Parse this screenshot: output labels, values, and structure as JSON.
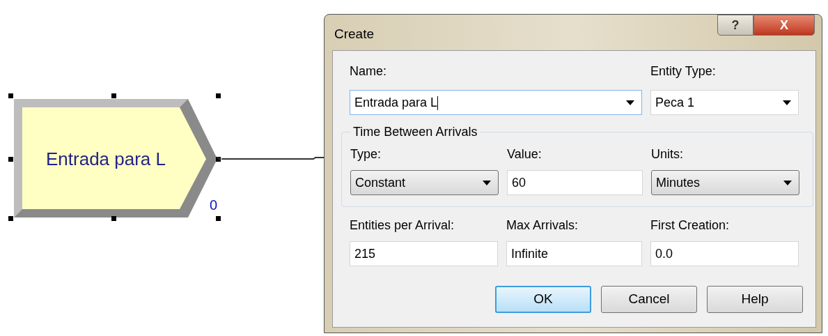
{
  "canvas": {
    "module": {
      "label": "Entrada para L",
      "selected": true,
      "counter": "0"
    }
  },
  "dialog": {
    "title": "Create",
    "title_buttons": [
      {
        "kind": "help",
        "label": "?"
      },
      {
        "kind": "close",
        "label": "X"
      }
    ],
    "name": {
      "label": "Name:",
      "value": "Entrada para L",
      "kind": "combo",
      "focused": true
    },
    "entity_type": {
      "label": "Entity Type:",
      "value": "Peca 1",
      "kind": "combo",
      "focused": false
    },
    "group": {
      "title": "Time Between Arrivals",
      "fields": [
        {
          "label": "Type:",
          "value": "Constant",
          "kind": "dropdown"
        },
        {
          "label": "Value:",
          "value": "60",
          "kind": "text"
        },
        {
          "label": "Units:",
          "value": "Minutes",
          "kind": "dropdown"
        }
      ]
    },
    "fields": [
      {
        "label": "Entities per Arrival:",
        "value": "215",
        "kind": "text"
      },
      {
        "label": "Max Arrivals:",
        "value": "Infinite",
        "kind": "text"
      },
      {
        "label": "First Creation:",
        "value": "0.0",
        "kind": "text"
      }
    ],
    "buttons": [
      {
        "label": "OK",
        "default": true
      },
      {
        "label": "Cancel",
        "default": false
      },
      {
        "label": "Help",
        "default": false
      }
    ]
  }
}
